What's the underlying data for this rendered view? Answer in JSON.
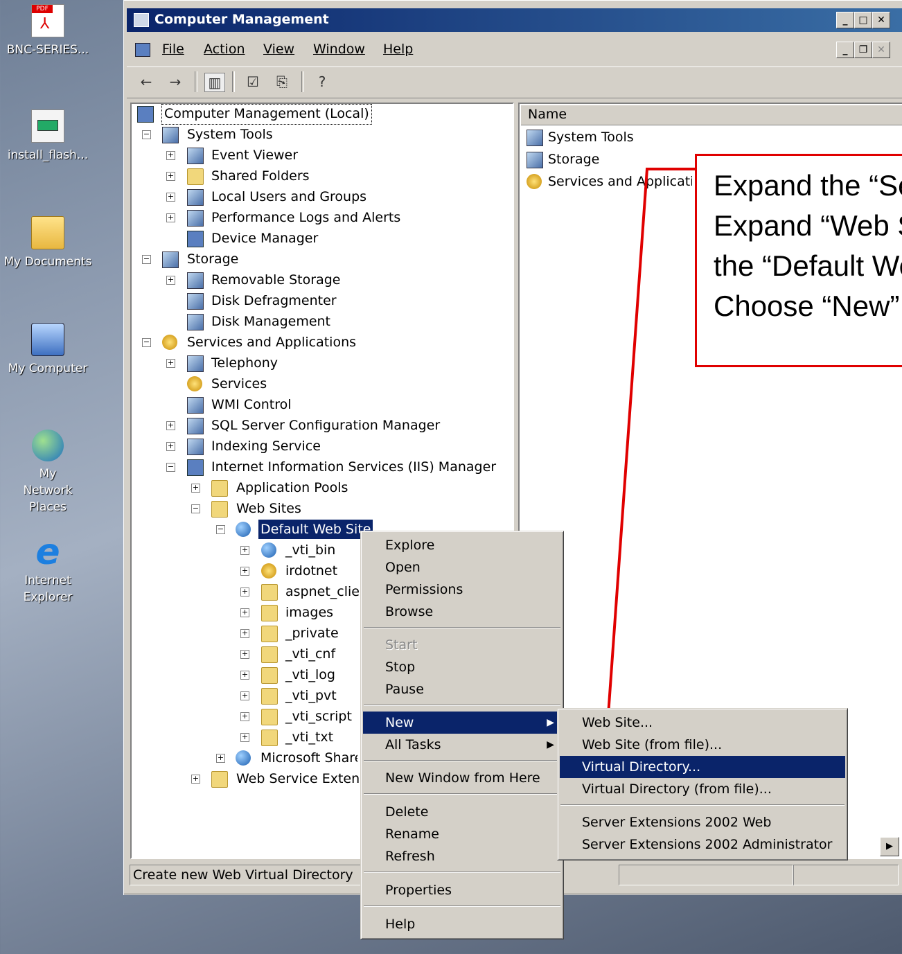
{
  "desktop": {
    "icons": [
      {
        "label": "BNC-SERIES...",
        "icon": "pdf-icon"
      },
      {
        "label": "install_flash...",
        "icon": "installer-icon"
      },
      {
        "label": "My Documents",
        "icon": "folder-icon"
      },
      {
        "label": "My Computer",
        "icon": "computer-icon"
      },
      {
        "label": "My Network Places",
        "icon": "network-icon"
      },
      {
        "label": "Internet Explorer",
        "icon": "ie-icon"
      }
    ]
  },
  "window": {
    "title": "Computer Management",
    "menu": [
      "File",
      "Action",
      "View",
      "Window",
      "Help"
    ]
  },
  "tree": {
    "root": "Computer Management (Local)",
    "items": [
      "System Tools",
      "Event Viewer",
      "Shared Folders",
      "Local Users and Groups",
      "Performance Logs and Alerts",
      "Device Manager",
      "Storage",
      "Removable Storage",
      "Disk Defragmenter",
      "Disk Management",
      "Services and Applications",
      "Telephony",
      "Services",
      "WMI Control",
      "SQL Server Configuration Manager",
      "Indexing Service",
      "Internet Information Services (IIS) Manager",
      "Application Pools",
      "Web Sites",
      "Default Web Site",
      "_vti_bin",
      "irdotnet",
      "aspnet_client",
      "images",
      "_private",
      "_vti_cnf",
      "_vti_log",
      "_vti_pvt",
      "_vti_script",
      "_vti_txt",
      "Microsoft SharePoint",
      "Web Service Extensions"
    ]
  },
  "list": {
    "header": "Name",
    "items": [
      "System Tools",
      "Storage",
      "Services and Applications"
    ]
  },
  "status": {
    "text": "Create new Web Virtual Directory"
  },
  "callout": {
    "lines": [
      "Expand the “Services and Applications”",
      "Expand “Web Sites”, right-click",
      "the  “Default Web Site” then",
      "Choose “New”"
    ]
  },
  "context_menu": {
    "items": [
      "Explore",
      "Open",
      "Permissions",
      "Browse",
      "Start",
      "Stop",
      "Pause",
      "New",
      "All Tasks",
      "New Window from Here",
      "Delete",
      "Rename",
      "Refresh",
      "Properties",
      "Help"
    ]
  },
  "submenu": {
    "items": [
      "Web Site...",
      "Web Site (from file)...",
      "Virtual Directory...",
      "Virtual Directory (from file)...",
      "Server Extensions 2002 Web",
      "Server Extensions 2002 Administrator"
    ]
  }
}
